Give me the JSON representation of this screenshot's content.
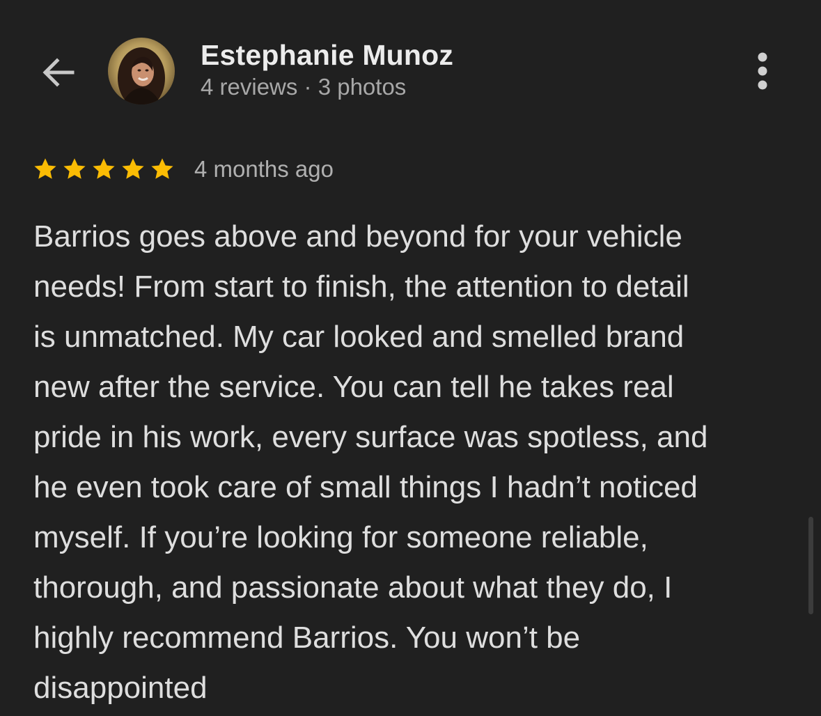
{
  "header": {
    "back_icon": "arrow-left-icon",
    "more_icon": "more-vert-icon",
    "reviewer_name": "Estephanie Munoz",
    "reviewer_meta": "4 reviews · 3 photos"
  },
  "review": {
    "rating": 5,
    "rating_max": 5,
    "time_ago": "4 months ago",
    "text_lines": [
      "Barrios goes above and beyond for your vehicle",
      "needs! From start to finish, the attention to detail",
      "is unmatched. My car looked and smelled brand",
      "new after the service. You can tell he takes real",
      "pride in his work, every surface was spotless, and",
      "he even took care of small things I hadn’t noticed",
      "myself. If you’re looking for someone reliable,",
      "thorough, and passionate about what they do, I",
      "highly recommend Barrios. You won’t be",
      "disappointed"
    ]
  },
  "colors": {
    "background": "#202020",
    "star": "#FBBC04",
    "text_primary": "#dedede",
    "text_secondary": "#a8a8a8"
  }
}
